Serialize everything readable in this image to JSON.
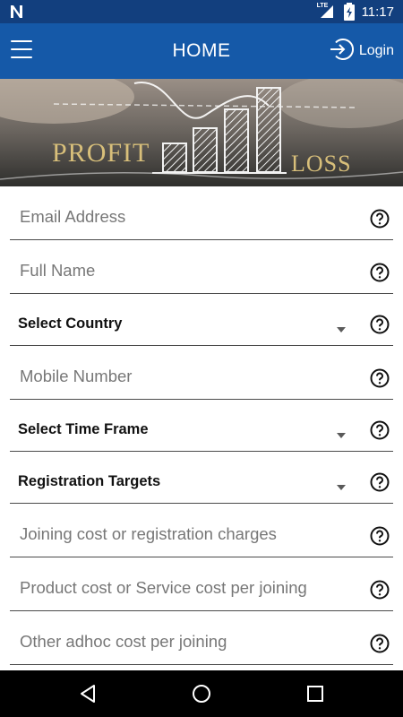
{
  "status_bar": {
    "time": "11:17",
    "network_label": "LTE",
    "icons": [
      "n-logo-icon",
      "signal-icon",
      "battery-charging-icon"
    ]
  },
  "app_bar": {
    "title": "HOME",
    "login_label": "Login",
    "icons": [
      "hamburger-menu-icon",
      "login-arrow-icon"
    ]
  },
  "banner": {
    "word_left": "PROFIT",
    "word_right": "LOSS"
  },
  "form": {
    "email": {
      "placeholder": "Email Address"
    },
    "full_name": {
      "placeholder": "Full Name"
    },
    "country": {
      "label": "Select Country"
    },
    "mobile": {
      "placeholder": "Mobile Number"
    },
    "time_frame": {
      "label": "Select Time Frame"
    },
    "registration_targets": {
      "label": "Registration Targets"
    },
    "joining_cost": {
      "placeholder": "Joining cost or registration charges"
    },
    "product_cost": {
      "placeholder": "Product cost or Service cost per joining"
    },
    "adhoc_cost": {
      "placeholder": "Other adhoc cost per joining"
    }
  },
  "colors": {
    "status_bar": "#123f7e",
    "app_bar": "#1559a8",
    "nav_bar": "#000000"
  },
  "nav_bar": {
    "icons": [
      "back-icon",
      "home-icon",
      "recents-icon"
    ]
  }
}
